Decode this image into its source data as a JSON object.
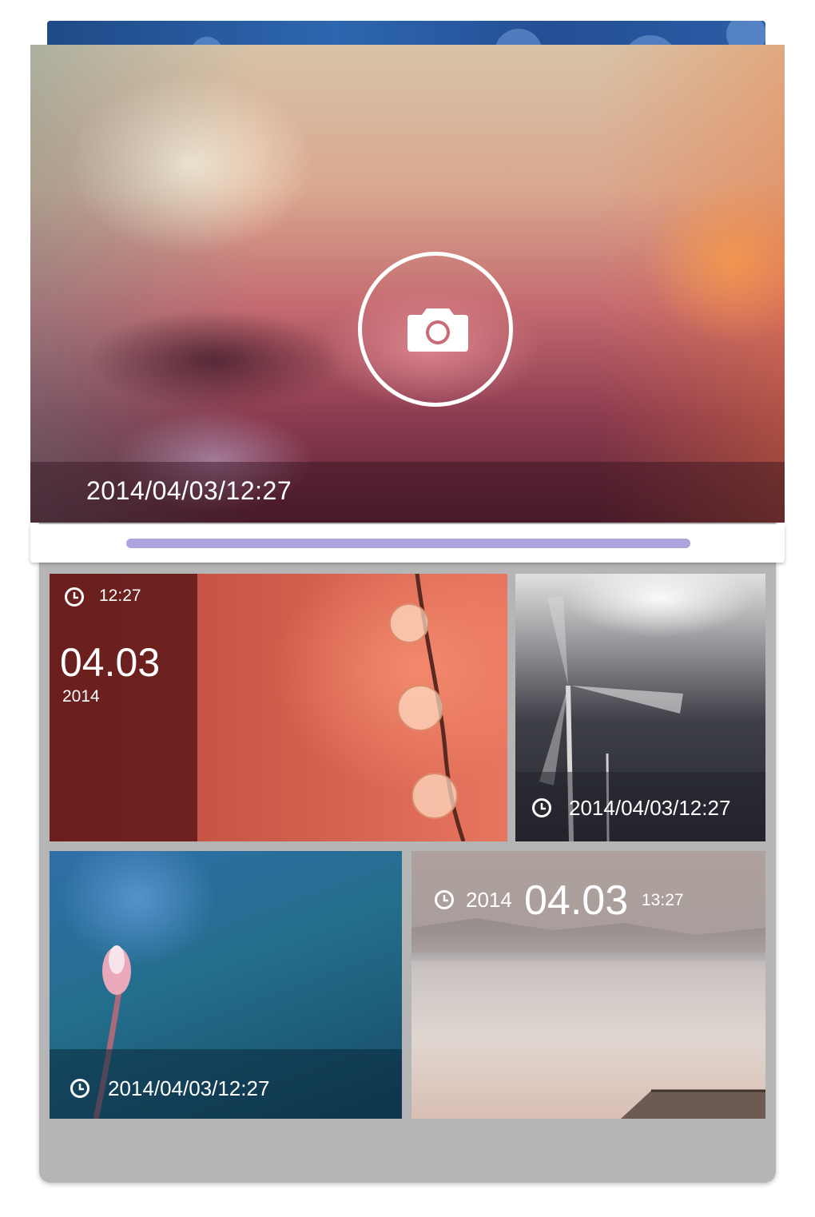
{
  "hero": {
    "timestamp": "2014/04/03/12:27",
    "camera_icon": "camera-icon"
  },
  "progress": {
    "value": 1.0,
    "color": "#aea4dc"
  },
  "tiles": {
    "droplets": {
      "time": "12:27",
      "date": "04.03",
      "year": "2014"
    },
    "windmill": {
      "timestamp": "2014/04/03/12:27"
    },
    "flower": {
      "timestamp": "2014/04/03/12:27"
    },
    "lake": {
      "year": "2014",
      "date": "04.03",
      "time": "13:27"
    }
  },
  "icons": {
    "clock": "clock-icon",
    "camera": "camera-icon"
  }
}
